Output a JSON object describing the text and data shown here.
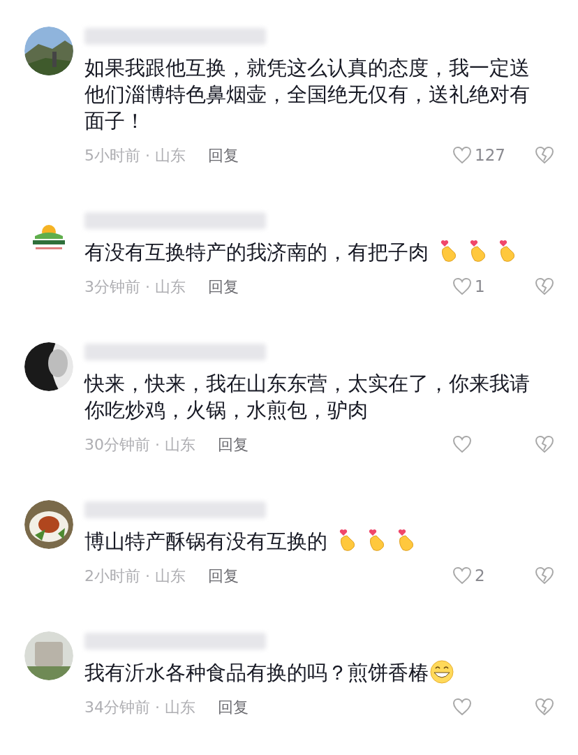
{
  "comments": [
    {
      "text": "如果我跟他互换，就凭这么认真的态度，我一定送他们淄博特色鼻烟壶，全国绝无仅有，送礼绝对有面子！",
      "meta": "5小时前 · 山东",
      "reply": "回复",
      "likes": "127"
    },
    {
      "text": "有没有互换特产的我济南的，有把子肉",
      "emojis": [
        {
          "kind": "finger-heart"
        },
        {
          "kind": "finger-heart"
        },
        {
          "kind": "finger-heart"
        }
      ],
      "meta": "3分钟前 · 山东",
      "reply": "回复",
      "likes": "1"
    },
    {
      "text": "快来，快来，我在山东东营，太实在了，你来我请你吃炒鸡，火锅，水煎包，驴肉",
      "meta": "30分钟前 · 山东",
      "reply": "回复"
    },
    {
      "text": "博山特产酥锅有没有互换的",
      "emojis": [
        {
          "kind": "finger-heart"
        },
        {
          "kind": "finger-heart"
        },
        {
          "kind": "finger-heart"
        }
      ],
      "meta": "2小时前 · 山东",
      "reply": "回复",
      "likes": "2"
    },
    {
      "text": "我有沂水各种食品有换的吗？煎饼香椿",
      "emojis": [
        {
          "kind": "grin"
        }
      ],
      "meta": "34分钟前 · 山东",
      "reply": "回复"
    }
  ]
}
